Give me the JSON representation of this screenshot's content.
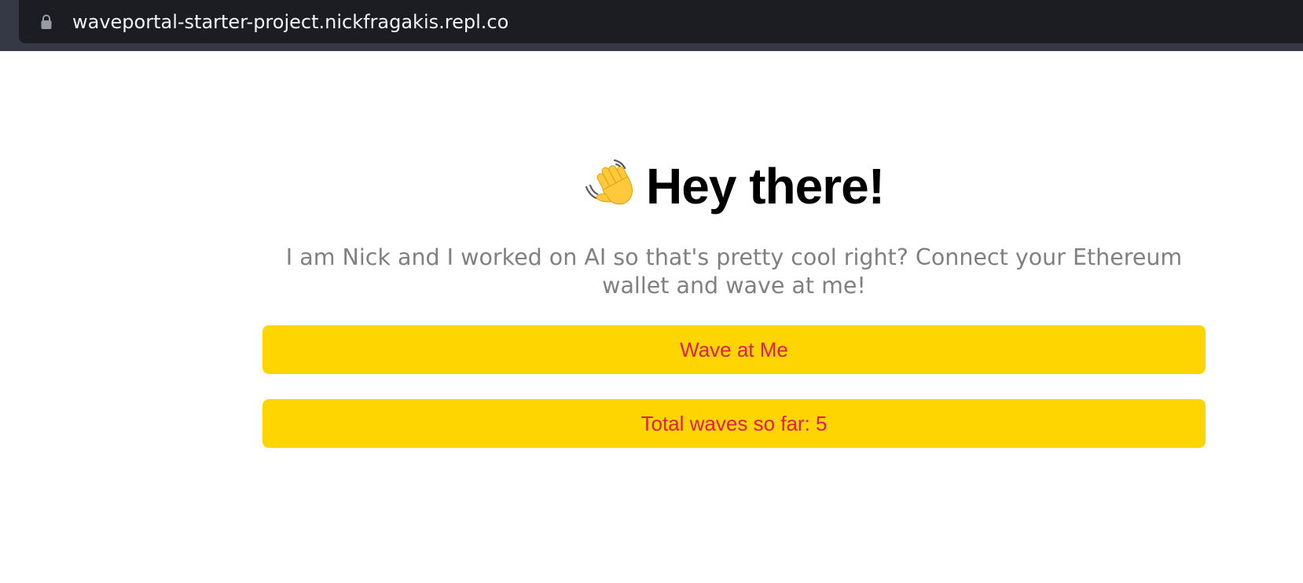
{
  "browser": {
    "url": "waveportal-starter-project.nickfragakis.repl.co",
    "lock_icon": "lock-icon"
  },
  "header": {
    "emoji": "👋",
    "emoji_icon": "waving-hand-icon",
    "title": "Hey there!"
  },
  "bio": {
    "text": "I am Nick and I worked on AI so that's pretty cool right? Connect your Ethereum wallet and wave at me!"
  },
  "buttons": {
    "wave_label": "Wave at Me",
    "total_label": "Total waves so far: 5"
  },
  "colors": {
    "browser_chrome": "#1b1d23",
    "button_background": "#ffd500",
    "button_text": "#dc1f4e",
    "bio_text": "#808080"
  }
}
